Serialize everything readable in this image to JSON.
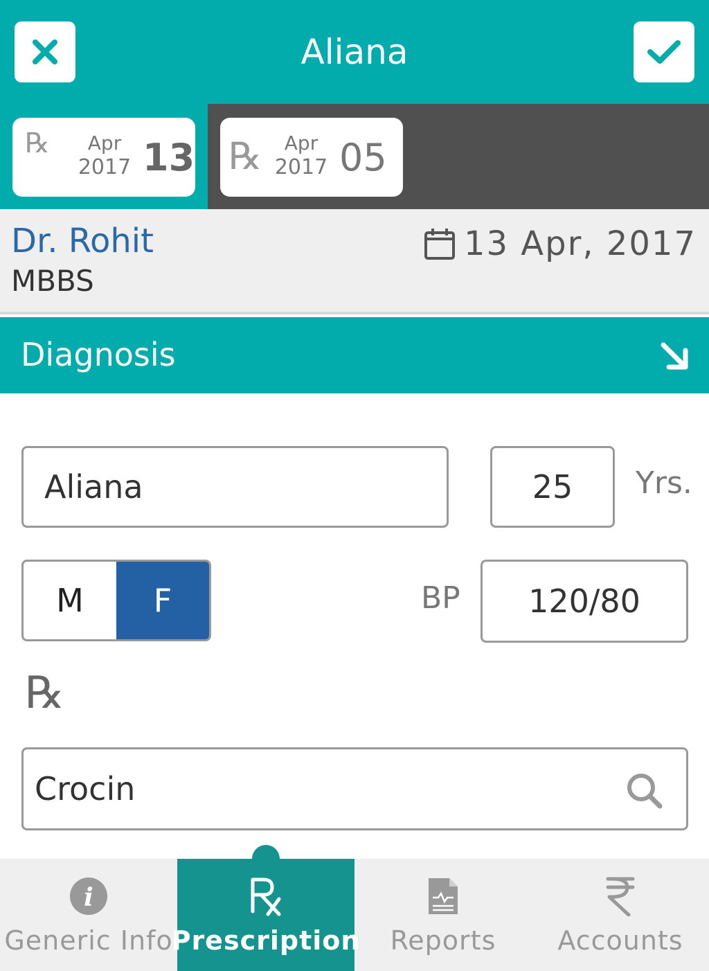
{
  "header": {
    "title": "Aliana",
    "close_icon": "close-icon",
    "confirm_icon": "check-icon",
    "accent": "#02acac"
  },
  "prescription_dates": [
    {
      "rx": "℞",
      "month": "Apr",
      "year": "2017",
      "day": "13",
      "active": true
    },
    {
      "rx": "℞",
      "month": "Apr",
      "year": "2017",
      "day": "05",
      "active": false
    }
  ],
  "doctor": {
    "name": "Dr. Rohit",
    "degree": "MBBS",
    "date": "13 Apr, 2017",
    "name_color": "#2b68a8"
  },
  "diagnosis": {
    "title": "Diagnosis",
    "expand_icon": "arrow-down-right-icon"
  },
  "form": {
    "patient_name": "Aliana",
    "age": "25",
    "age_unit": "Yrs.",
    "gender_options": [
      "M",
      "F"
    ],
    "gender_selected": "F",
    "bp_label": "BP",
    "bp_value": "120/80",
    "rx_symbol": "℞",
    "medicine_search": "Crocin",
    "selected_color": "#2360a4"
  },
  "bottom_nav": {
    "items": [
      {
        "label": "Generic Info",
        "icon": "info-icon",
        "active": false
      },
      {
        "label": "Prescription",
        "icon": "rx-icon",
        "active": true
      },
      {
        "label": "Reports",
        "icon": "report-icon",
        "active": false
      },
      {
        "label": "Accounts",
        "icon": "rupee-icon",
        "active": false
      }
    ],
    "active_color": "#14938f"
  }
}
